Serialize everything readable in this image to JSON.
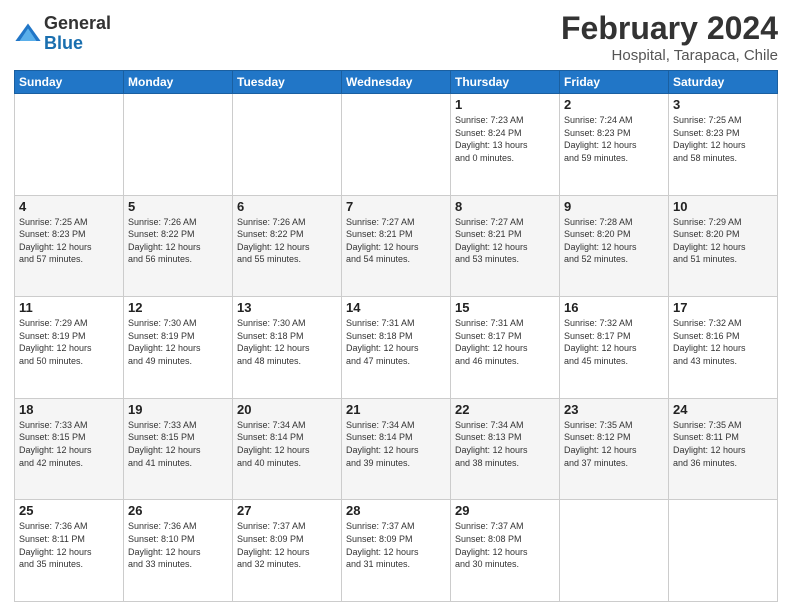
{
  "logo": {
    "general": "General",
    "blue": "Blue"
  },
  "title": "February 2024",
  "subtitle": "Hospital, Tarapaca, Chile",
  "days_of_week": [
    "Sunday",
    "Monday",
    "Tuesday",
    "Wednesday",
    "Thursday",
    "Friday",
    "Saturday"
  ],
  "weeks": [
    [
      {
        "day": "",
        "info": ""
      },
      {
        "day": "",
        "info": ""
      },
      {
        "day": "",
        "info": ""
      },
      {
        "day": "",
        "info": ""
      },
      {
        "day": "1",
        "info": "Sunrise: 7:23 AM\nSunset: 8:24 PM\nDaylight: 13 hours\nand 0 minutes."
      },
      {
        "day": "2",
        "info": "Sunrise: 7:24 AM\nSunset: 8:23 PM\nDaylight: 12 hours\nand 59 minutes."
      },
      {
        "day": "3",
        "info": "Sunrise: 7:25 AM\nSunset: 8:23 PM\nDaylight: 12 hours\nand 58 minutes."
      }
    ],
    [
      {
        "day": "4",
        "info": "Sunrise: 7:25 AM\nSunset: 8:23 PM\nDaylight: 12 hours\nand 57 minutes."
      },
      {
        "day": "5",
        "info": "Sunrise: 7:26 AM\nSunset: 8:22 PM\nDaylight: 12 hours\nand 56 minutes."
      },
      {
        "day": "6",
        "info": "Sunrise: 7:26 AM\nSunset: 8:22 PM\nDaylight: 12 hours\nand 55 minutes."
      },
      {
        "day": "7",
        "info": "Sunrise: 7:27 AM\nSunset: 8:21 PM\nDaylight: 12 hours\nand 54 minutes."
      },
      {
        "day": "8",
        "info": "Sunrise: 7:27 AM\nSunset: 8:21 PM\nDaylight: 12 hours\nand 53 minutes."
      },
      {
        "day": "9",
        "info": "Sunrise: 7:28 AM\nSunset: 8:20 PM\nDaylight: 12 hours\nand 52 minutes."
      },
      {
        "day": "10",
        "info": "Sunrise: 7:29 AM\nSunset: 8:20 PM\nDaylight: 12 hours\nand 51 minutes."
      }
    ],
    [
      {
        "day": "11",
        "info": "Sunrise: 7:29 AM\nSunset: 8:19 PM\nDaylight: 12 hours\nand 50 minutes."
      },
      {
        "day": "12",
        "info": "Sunrise: 7:30 AM\nSunset: 8:19 PM\nDaylight: 12 hours\nand 49 minutes."
      },
      {
        "day": "13",
        "info": "Sunrise: 7:30 AM\nSunset: 8:18 PM\nDaylight: 12 hours\nand 48 minutes."
      },
      {
        "day": "14",
        "info": "Sunrise: 7:31 AM\nSunset: 8:18 PM\nDaylight: 12 hours\nand 47 minutes."
      },
      {
        "day": "15",
        "info": "Sunrise: 7:31 AM\nSunset: 8:17 PM\nDaylight: 12 hours\nand 46 minutes."
      },
      {
        "day": "16",
        "info": "Sunrise: 7:32 AM\nSunset: 8:17 PM\nDaylight: 12 hours\nand 45 minutes."
      },
      {
        "day": "17",
        "info": "Sunrise: 7:32 AM\nSunset: 8:16 PM\nDaylight: 12 hours\nand 43 minutes."
      }
    ],
    [
      {
        "day": "18",
        "info": "Sunrise: 7:33 AM\nSunset: 8:15 PM\nDaylight: 12 hours\nand 42 minutes."
      },
      {
        "day": "19",
        "info": "Sunrise: 7:33 AM\nSunset: 8:15 PM\nDaylight: 12 hours\nand 41 minutes."
      },
      {
        "day": "20",
        "info": "Sunrise: 7:34 AM\nSunset: 8:14 PM\nDaylight: 12 hours\nand 40 minutes."
      },
      {
        "day": "21",
        "info": "Sunrise: 7:34 AM\nSunset: 8:14 PM\nDaylight: 12 hours\nand 39 minutes."
      },
      {
        "day": "22",
        "info": "Sunrise: 7:34 AM\nSunset: 8:13 PM\nDaylight: 12 hours\nand 38 minutes."
      },
      {
        "day": "23",
        "info": "Sunrise: 7:35 AM\nSunset: 8:12 PM\nDaylight: 12 hours\nand 37 minutes."
      },
      {
        "day": "24",
        "info": "Sunrise: 7:35 AM\nSunset: 8:11 PM\nDaylight: 12 hours\nand 36 minutes."
      }
    ],
    [
      {
        "day": "25",
        "info": "Sunrise: 7:36 AM\nSunset: 8:11 PM\nDaylight: 12 hours\nand 35 minutes."
      },
      {
        "day": "26",
        "info": "Sunrise: 7:36 AM\nSunset: 8:10 PM\nDaylight: 12 hours\nand 33 minutes."
      },
      {
        "day": "27",
        "info": "Sunrise: 7:37 AM\nSunset: 8:09 PM\nDaylight: 12 hours\nand 32 minutes."
      },
      {
        "day": "28",
        "info": "Sunrise: 7:37 AM\nSunset: 8:09 PM\nDaylight: 12 hours\nand 31 minutes."
      },
      {
        "day": "29",
        "info": "Sunrise: 7:37 AM\nSunset: 8:08 PM\nDaylight: 12 hours\nand 30 minutes."
      },
      {
        "day": "",
        "info": ""
      },
      {
        "day": "",
        "info": ""
      }
    ]
  ]
}
